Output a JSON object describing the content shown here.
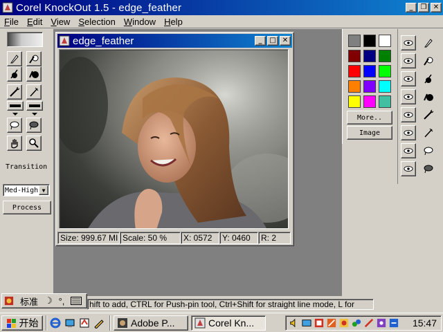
{
  "app": {
    "title": "Corel KnockOut 1.5 - edge_feather",
    "menu": [
      "File",
      "Edit",
      "View",
      "Selection",
      "Window",
      "Help"
    ],
    "window_buttons": [
      "_",
      "❒",
      "✕"
    ]
  },
  "toolbox": {
    "transition_label": "Transition",
    "quality_value": "Med-High",
    "process_label": "Process"
  },
  "document": {
    "title": "edge_feather",
    "window_buttons": [
      "_",
      "□",
      "✕"
    ],
    "status": {
      "size": "Size: 999.67 MI",
      "scale": "Scale:   50 %",
      "x": "X: 0572",
      "y": "Y: 0460",
      "r": "R: 2"
    }
  },
  "palette": {
    "colors": [
      "#808080",
      "#000000",
      "#ffffff",
      "#800000",
      "#000080",
      "#008000",
      "#ff0000",
      "#0000ff",
      "#00ff00",
      "#ff8000",
      "#8000ff",
      "#00ffff",
      "#ffff00",
      "#ff00ff",
      "#40c0a0"
    ],
    "more_label": "More..",
    "image_label": "Image"
  },
  "status_bar": {
    "text": "hift to add, CTRL for Push-pin tool, Ctrl+Shift for straight line mode, L for"
  },
  "ime": {
    "label": "标准"
  },
  "taskbar": {
    "start_label": "开始",
    "tasks": [
      "Adobe P...",
      "Corel Kn..."
    ],
    "clock": "15:47"
  }
}
